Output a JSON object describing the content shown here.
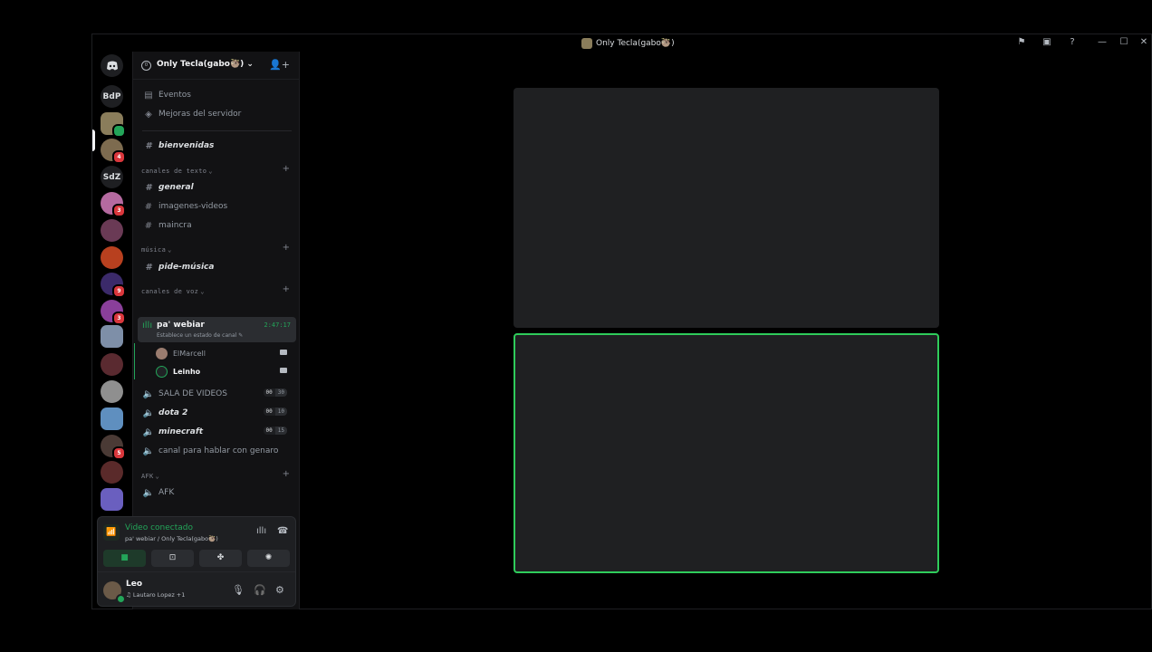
{
  "window": {
    "title": "Only Tecla(gabo🦥)",
    "controls": {
      "minimize": "—",
      "maximize": "☐",
      "close": "✕"
    }
  },
  "rail": {
    "servers": [
      {
        "label": "BdP"
      },
      {
        "label": "",
        "selected": true
      },
      {
        "label": "",
        "badge": "4"
      },
      {
        "label": "SdZ"
      },
      {
        "label": "",
        "badge": "3"
      },
      {
        "label": ""
      },
      {
        "label": ""
      },
      {
        "label": "",
        "badge": "9"
      },
      {
        "label": "",
        "badge": "3"
      },
      {
        "label": ""
      },
      {
        "label": ""
      },
      {
        "label": ""
      },
      {
        "label": ""
      },
      {
        "label": "",
        "badge": "5"
      },
      {
        "label": ""
      },
      {
        "label": ""
      }
    ]
  },
  "server": {
    "name": "Only Tecla(gabo🦥)",
    "icon_text": "0"
  },
  "sidebar": {
    "events": "Eventos",
    "boosts": "Mejoras del servidor",
    "welcome": "bienvenidas",
    "categories": {
      "text": "canales de texto",
      "music": "música",
      "voice": "canales de voz",
      "afk": "AFK"
    },
    "text_channels": [
      "general",
      "imagenes-videos",
      "maincra"
    ],
    "music_channels": [
      "pide-música"
    ],
    "active_voice": {
      "name": "pa' webiar",
      "time": "2:47:17",
      "status": "Establece un estado de canal"
    },
    "voice_users": [
      {
        "name": "ElMarcell"
      },
      {
        "name": "Leinho"
      }
    ],
    "voice_channels": [
      {
        "name": "SALA DE VIDEOS",
        "count": "00",
        "limit": "30"
      },
      {
        "name": "dota 2",
        "count": "00",
        "limit": "10"
      },
      {
        "name": "minecraft",
        "count": "00",
        "limit": "15"
      },
      {
        "name": "canal para hablar con genaro"
      }
    ],
    "afk_channels": [
      "AFK"
    ]
  },
  "voice_panel": {
    "title": "Video conectado",
    "subtitle": "pa' webiar / Only Tecla(gabo🦥)"
  },
  "user": {
    "name": "Leo",
    "activity": "♫ Lautaro Lopez +1"
  },
  "colors": {
    "accent_green": "#23a559",
    "speaking_border": "#2fcc5b",
    "badge_red": "#da373c"
  }
}
